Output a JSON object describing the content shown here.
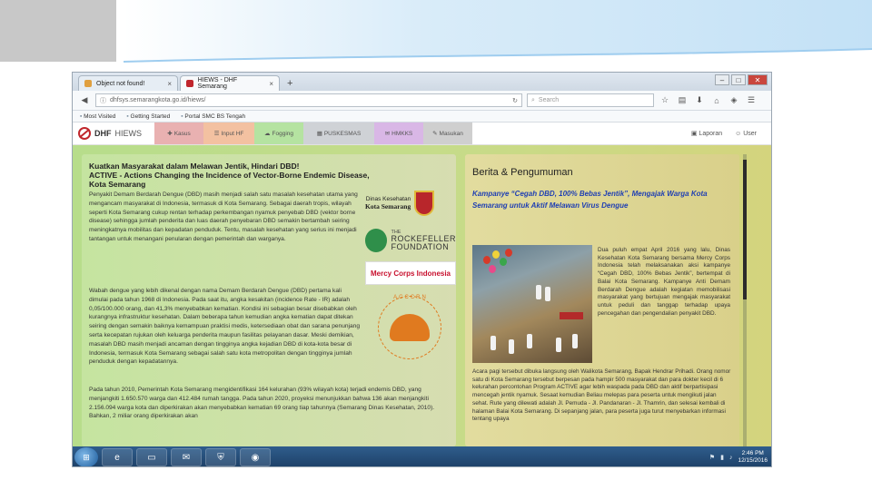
{
  "browser": {
    "tabs": [
      {
        "label": "Object not found!",
        "active": false
      },
      {
        "label": "HIEWS - DHF Semarang",
        "active": true
      }
    ],
    "url": "dhfsys.semarangkota.go.id/hiews/",
    "search_placeholder": "Search",
    "bookmarks": [
      "Most Visited",
      "Getting Started",
      "Portal SMC BS Tengah"
    ]
  },
  "app": {
    "logo_text": "DHF",
    "logo_sub": "HIEWS",
    "menu": [
      {
        "label": "Kasus",
        "color": "#e9b1b1"
      },
      {
        "label": "Input HF",
        "color": "#f3c1a1"
      },
      {
        "label": "Fogging",
        "color": "#b5e3a1"
      },
      {
        "label": "PUSKESMAS",
        "color": "#cfd2d6"
      },
      {
        "label": "HMKKS",
        "color": "#d9b7e6"
      },
      {
        "label": "Masukan",
        "color": "#cfcfcf"
      }
    ],
    "laporan_label": "Laporan",
    "user_label": "User"
  },
  "left": {
    "title": "Kuatkan Masyarakat dalam Melawan Jentik, Hindari DBD!",
    "subtitle": "ACTIVE - Actions Changing the Incidence of Vector-Borne Endemic Disease, Kota Semarang",
    "p1": "Penyakit Demam Berdarah Dengue (DBD) masih menjadi salah satu masalah kesehatan utama yang mengancam masyarakat di Indonesia, termasuk di Kota Semarang. Sebagai daerah tropis, wilayah seperti Kota Semarang cukup rentan terhadap perkembangan nyamuk penyebab DBD (vektor borne disease) sehingga jumlah penderita dan luas daerah penyebaran DBD semakin bertambah seiring meningkatnya mobilitas dan kepadatan penduduk. Tentu, masalah kesehatan yang serius ini menjadi tantangan untuk menangani penularan dengan pemerintah dan warganya.",
    "p2": "Wabah dengue yang lebih dikenal dengan nama Demam Berdarah Dengue (DBD) pertama kali dimulai pada tahun 1968 di Indonesia. Pada saat itu, angka kesakitan (incidence Rate - IR) adalah 0,05/100.000 orang, dan 41,3% menyebabkan kematian. Kondisi ini sebagian besar disebabkan oleh kurangnya infrastruktur kesehatan. Dalam beberapa tahun kemudian angka kematian dapat ditekan seiring dengan semakin baiknya kemampuan praktisi medis, ketersediaan obat dan sarana penunjang serta kecepatan rujukan oleh keluarga penderita maupun fasilitas pelayanan dasar. Meski demikian, masalah DBD masih menjadi ancaman dengan tingginya angka kejadian DBD di kota-kota besar di Indonesia, termasuk Kota Semarang sebagai salah satu kota metropolitan dengan tingginya jumlah penduduk dengan kepadatannya.",
    "p3": "Pada tahun 2010, Pemerintah Kota Semarang mengidentifikasi 164 kelurahan (93% wilayah kota) terjadi endemis DBD, yang menjangkiti 1.650.570 warga dan 412.484 rumah tangga. Pada tahun 2020, proyeksi menunjukkan bahwa 136 akan menjangkiti 2.156.094 warga kota dan diperkirakan akan menyebabkan kematian 69 orang tiap tahunnya (Semarang Dinas Kesehatan, 2010). Bahkan, 2 miliar orang diperkirakan akan",
    "logos": {
      "dinkes_line1": "Dinas Kesehatan",
      "dinkes_line2": "Kota Semarang",
      "rockefeller_the": "THE",
      "rockefeller_name": "ROCKEFELLER",
      "rockefeller_foundation": "FOUNDATION",
      "mercy": "Mercy Corps Indonesia",
      "acccrn": "ACCCRN"
    }
  },
  "right": {
    "title": "Berita & Pengumuman",
    "campaign": "Kampanye “Cegah DBD, 100% Bebas Jentik”, Mengajak Warga Kota Semarang untuk Aktif Melawan Virus Dengue",
    "col_text": "Dua puluh empat April 2016 yang lalu, Dinas Kesehatan Kota Semarang bersama Mercy Corps Indonesia telah melaksanakan aksi kampanye “Cegah DBD, 100% Bebas Jentik”, bertempat di Balai Kota Semarang. Kampanye Anti Demam Berdarah Dengue adalah kegiatan memobilisasi masyarakat yang bertujuan mengajak masyarakat untuk peduli dan tanggap terhadap upaya pencegahan dan pengendalian penyakit DBD.",
    "wide_text": "Acara pagi tersebut dibuka langsung oleh Walikota Semarang, Bapak Hendrar Prihadi. Orang nomor satu di Kota Semarang tersebut berpesan pada hampir 500 masyarakat dan para dokter kecil di 6 kelurahan percontohan Program ACTIVE agar lebih waspada pada DBD dan aktif berpartisipasi mencegah jentik nyamuk. Sesaat kemudian Beliau melepas para peserta untuk mengikuti jalan sehat. Rute yang dilewati adalah Jl. Pemuda - Jl. Pandanaran - Jl. Thamrin, dan selesai kembali di halaman Balai Kota Semarang. Di sepanjang jalan, para peserta juga turut menyebarkan informasi tentang upaya"
  },
  "taskbar": {
    "time": "2:46 PM",
    "date": "12/15/2016"
  }
}
